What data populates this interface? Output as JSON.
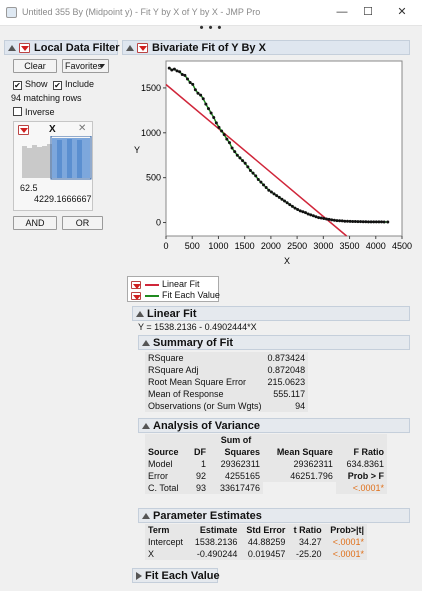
{
  "window": {
    "title": "Untitled 355 By (Midpoint y) - Fit Y by X of Y by X - JMP Pro",
    "minimize": "—",
    "maximize": "☐",
    "close": "✕",
    "more": "• • •"
  },
  "filter": {
    "title": "Local Data Filter",
    "clear_label": "Clear",
    "favorites_label": "Favorites",
    "show_label": "Show",
    "include_label": "Include",
    "show_checked": true,
    "include_checked": true,
    "matching": "94 matching rows",
    "inverse_label": "Inverse",
    "column_name": "X",
    "range_min": "62.5",
    "range_max": "4229.1666667",
    "and_label": "AND",
    "or_label": "OR"
  },
  "bivariate": {
    "title": "Bivariate Fit of Y By X"
  },
  "chart_data": {
    "type": "scatter",
    "xlabel": "X",
    "ylabel": "Y",
    "xlim": [
      0,
      4500
    ],
    "ylim": [
      -150,
      1800
    ],
    "xticks": [
      "0",
      "500",
      "1000",
      "1500",
      "2000",
      "2500",
      "3000",
      "3500",
      "4000",
      "4500"
    ],
    "yticks": [
      "0",
      "500",
      "1000",
      "1500"
    ],
    "points": [
      [
        62.5,
        1720
      ],
      [
        110,
        1700
      ],
      [
        160,
        1710
      ],
      [
        210,
        1690
      ],
      [
        260,
        1680
      ],
      [
        310,
        1650
      ],
      [
        360,
        1640
      ],
      [
        410,
        1600
      ],
      [
        460,
        1560
      ],
      [
        510,
        1540
      ],
      [
        560,
        1480
      ],
      [
        610,
        1440
      ],
      [
        660,
        1420
      ],
      [
        710,
        1380
      ],
      [
        760,
        1320
      ],
      [
        810,
        1270
      ],
      [
        860,
        1220
      ],
      [
        910,
        1170
      ],
      [
        960,
        1110
      ],
      [
        1010,
        1060
      ],
      [
        1060,
        1020
      ],
      [
        1110,
        980
      ],
      [
        1160,
        930
      ],
      [
        1210,
        890
      ],
      [
        1260,
        830
      ],
      [
        1310,
        790
      ],
      [
        1360,
        750
      ],
      [
        1410,
        720
      ],
      [
        1460,
        690
      ],
      [
        1510,
        660
      ],
      [
        1560,
        620
      ],
      [
        1610,
        580
      ],
      [
        1660,
        550
      ],
      [
        1710,
        520
      ],
      [
        1760,
        480
      ],
      [
        1810,
        450
      ],
      [
        1860,
        420
      ],
      [
        1910,
        390
      ],
      [
        1960,
        360
      ],
      [
        2010,
        340
      ],
      [
        2060,
        320
      ],
      [
        2110,
        300
      ],
      [
        2160,
        280
      ],
      [
        2210,
        260
      ],
      [
        2260,
        240
      ],
      [
        2310,
        220
      ],
      [
        2360,
        200
      ],
      [
        2410,
        180
      ],
      [
        2460,
        160
      ],
      [
        2510,
        145
      ],
      [
        2560,
        130
      ],
      [
        2610,
        120
      ],
      [
        2660,
        110
      ],
      [
        2710,
        95
      ],
      [
        2760,
        85
      ],
      [
        2810,
        75
      ],
      [
        2860,
        65
      ],
      [
        2910,
        55
      ],
      [
        2960,
        50
      ],
      [
        3010,
        45
      ],
      [
        3060,
        40
      ],
      [
        3110,
        35
      ],
      [
        3160,
        30
      ],
      [
        3210,
        25
      ],
      [
        3260,
        22
      ],
      [
        3310,
        20
      ],
      [
        3360,
        18
      ],
      [
        3410,
        15
      ],
      [
        3460,
        14
      ],
      [
        3510,
        13
      ],
      [
        3560,
        12
      ],
      [
        3610,
        11
      ],
      [
        3660,
        10
      ],
      [
        3710,
        10
      ],
      [
        3760,
        9
      ],
      [
        3810,
        9
      ],
      [
        3860,
        8
      ],
      [
        3910,
        8
      ],
      [
        3960,
        8
      ],
      [
        4010,
        7
      ],
      [
        4060,
        7
      ],
      [
        4110,
        7
      ],
      [
        4160,
        6
      ],
      [
        4229,
        6
      ]
    ],
    "linear_fit": {
      "intercept": 1538.2136,
      "slope": -0.4902444
    },
    "linear_fit_color": "#d0263a",
    "each_value_color": "#1f8a1f",
    "point_color": "#111111"
  },
  "legend": {
    "linear_fit": "Linear Fit",
    "fit_each_value": "Fit Each Value"
  },
  "linear_fit": {
    "title": "Linear Fit",
    "equation": "Y = 1538.2136 - 0.4902444*X"
  },
  "summary": {
    "title": "Summary of Fit",
    "rows": [
      {
        "label": "RSquare",
        "value": "0.873424"
      },
      {
        "label": "RSquare Adj",
        "value": "0.872048"
      },
      {
        "label": "Root Mean Square Error",
        "value": "215.0623"
      },
      {
        "label": "Mean of Response",
        "value": "555.117"
      },
      {
        "label": "Observations (or Sum Wgts)",
        "value": "94"
      }
    ]
  },
  "anova": {
    "title": "Analysis of Variance",
    "col_sum": "Sum of",
    "col_squares": "Squares",
    "headers": [
      "Source",
      "DF",
      "Squares",
      "Mean Square",
      "F Ratio"
    ],
    "rows": [
      {
        "source": "Model",
        "df": "1",
        "ss": "29362311",
        "ms": "29362311",
        "f": "634.8361"
      },
      {
        "source": "Error",
        "df": "92",
        "ss": "4255165",
        "ms": "46251.796",
        "f": "Prob > F"
      },
      {
        "source": "C. Total",
        "df": "93",
        "ss": "33617476",
        "ms": "",
        "f": "<.0001*"
      }
    ]
  },
  "params": {
    "title": "Parameter Estimates",
    "headers": [
      "Term",
      "Estimate",
      "Std Error",
      "t Ratio",
      "Prob>|t|"
    ],
    "rows": [
      {
        "term": "Intercept",
        "est": "1538.2136",
        "se": "44.88259",
        "t": "34.27",
        "p": "<.0001*"
      },
      {
        "term": "X",
        "est": "-0.490244",
        "se": "0.019457",
        "t": "-25.20",
        "p": "<.0001*"
      }
    ]
  },
  "fit_each": {
    "title": "Fit Each Value"
  }
}
